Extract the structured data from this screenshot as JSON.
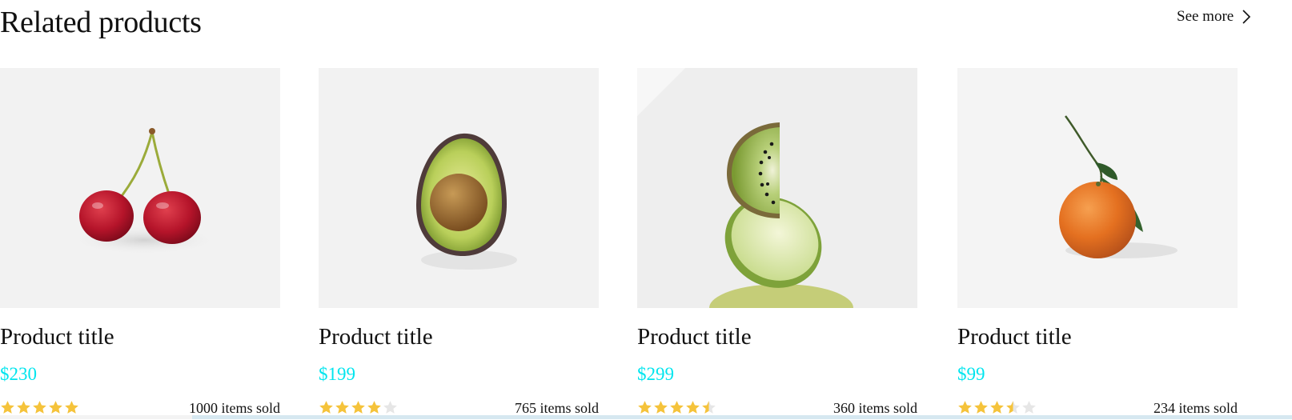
{
  "section": {
    "title": "Related products",
    "see_more_label": "See more",
    "see_more_icon": "chevron-right-icon"
  },
  "theme": {
    "price_color": "#00e5ee",
    "star_filled_color": "#f5c33b",
    "star_empty_color": "#e6e6e6"
  },
  "products": [
    {
      "title": "Product title",
      "price": "$230",
      "rating": 5,
      "sold": "1000 items sold",
      "image": "cherries"
    },
    {
      "title": "Product title",
      "price": "$199",
      "rating": 4,
      "sold": "765 items sold",
      "image": "avocado-half"
    },
    {
      "title": "Product title",
      "price": "$299",
      "rating": 4.5,
      "sold": "360 items sold",
      "image": "kiwi-and-lime"
    },
    {
      "title": "Product title",
      "price": "$99",
      "rating": 3.5,
      "sold": "234 items sold",
      "image": "tangerine"
    }
  ]
}
